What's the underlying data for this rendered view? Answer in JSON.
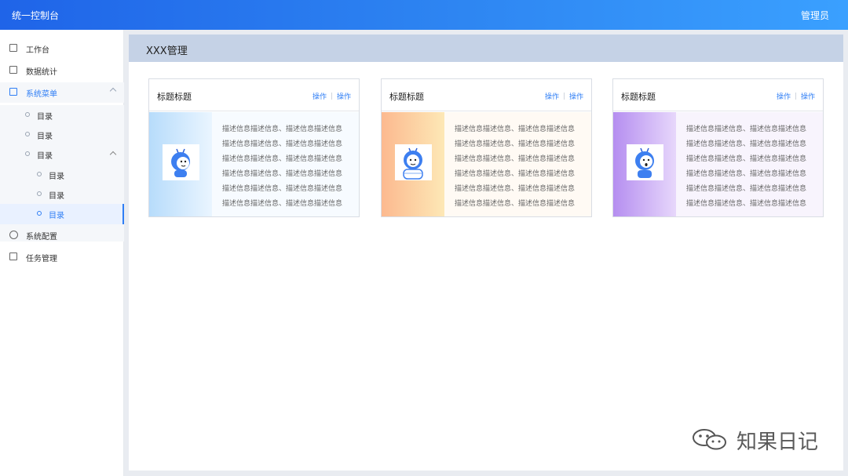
{
  "header": {
    "app_title": "统一控制台",
    "user": "管理员"
  },
  "sidebar": {
    "items": [
      {
        "label": "工作台",
        "icon": "workbench-icon"
      },
      {
        "label": "数据统计",
        "icon": "chart-icon"
      },
      {
        "label": "系统菜单",
        "icon": "menu-icon"
      },
      {
        "label": "系统配置",
        "icon": "settings-circle-icon"
      },
      {
        "label": "任务管理",
        "icon": "task-icon"
      }
    ],
    "sub": [
      {
        "label": "目录"
      },
      {
        "label": "目录"
      },
      {
        "label": "目录"
      },
      {
        "label": "目录"
      },
      {
        "label": "目录"
      },
      {
        "label": "目录"
      }
    ]
  },
  "main": {
    "page_title": "XXX管理",
    "cards": [
      {
        "title": "标题标题",
        "action1": "操作",
        "action2": "操作",
        "lines": [
          "描述信息描述信息、描述信息描述信息",
          "描述信息描述信息、描述信息描述信息",
          "描述信息描述信息、描述信息描述信息",
          "描述信息描述信息、描述信息描述信息",
          "描述信息描述信息、描述信息描述信息",
          "描述信息描述信息、描述信息描述信息"
        ],
        "accent_gradient": [
          "#b7dcfb",
          "#eaf5ff"
        ]
      },
      {
        "title": "标题标题",
        "action1": "操作",
        "action2": "操作",
        "lines": [
          "描述信息描述信息、描述信息描述信息",
          "描述信息描述信息、描述信息描述信息",
          "描述信息描述信息、描述信息描述信息",
          "描述信息描述信息、描述信息描述信息",
          "描述信息描述信息、描述信息描述信息",
          "描述信息描述信息、描述信息描述信息"
        ],
        "accent_gradient": [
          "#fcb98f",
          "#fde8b6"
        ]
      },
      {
        "title": "标题标题",
        "action1": "操作",
        "action2": "操作",
        "lines": [
          "描述信息描述信息、描述信息描述信息",
          "描述信息描述信息、描述信息描述信息",
          "描述信息描述信息、描述信息描述信息",
          "描述信息描述信息、描述信息描述信息",
          "描述信息描述信息、描述信息描述信息",
          "描述信息描述信息、描述信息描述信息"
        ],
        "accent_gradient": [
          "#b58ef0",
          "#e7d7fb"
        ]
      }
    ]
  },
  "watermark": {
    "text": "知果日记"
  },
  "colors": {
    "brand": "#2f7ef5",
    "header_bar": "#c5d2e6"
  }
}
